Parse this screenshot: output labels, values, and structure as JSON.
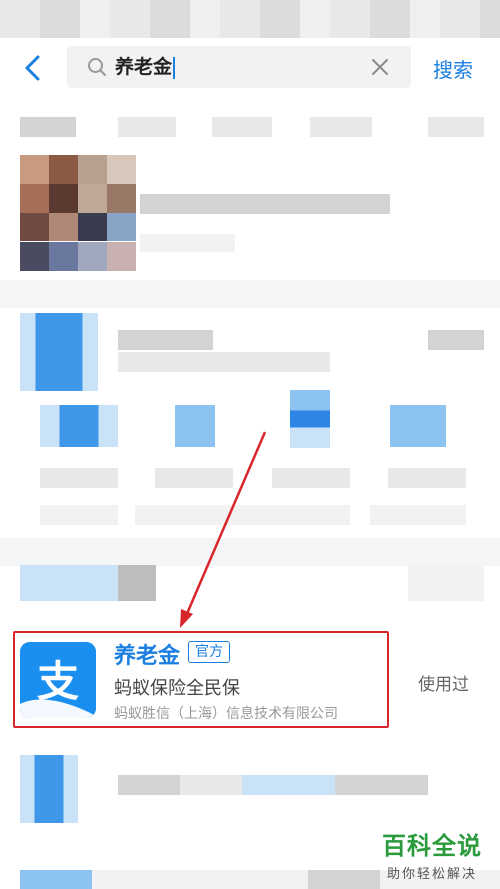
{
  "search": {
    "query": "养老金",
    "search_label": "搜索"
  },
  "result": {
    "name": "养老金",
    "badge": "官方",
    "description": "蚂蚁保险全民保",
    "company": "蚂蚁胜信（上海）信息技术有限公司",
    "status": "使用过",
    "icon_glyph": "支"
  },
  "watermark": {
    "title": "百科全说",
    "subtitle": "助你轻松解决"
  },
  "colors": {
    "accent": "#1a7fe0",
    "icon_bg": "#1a8ff0",
    "highlight": "#d9262b"
  }
}
